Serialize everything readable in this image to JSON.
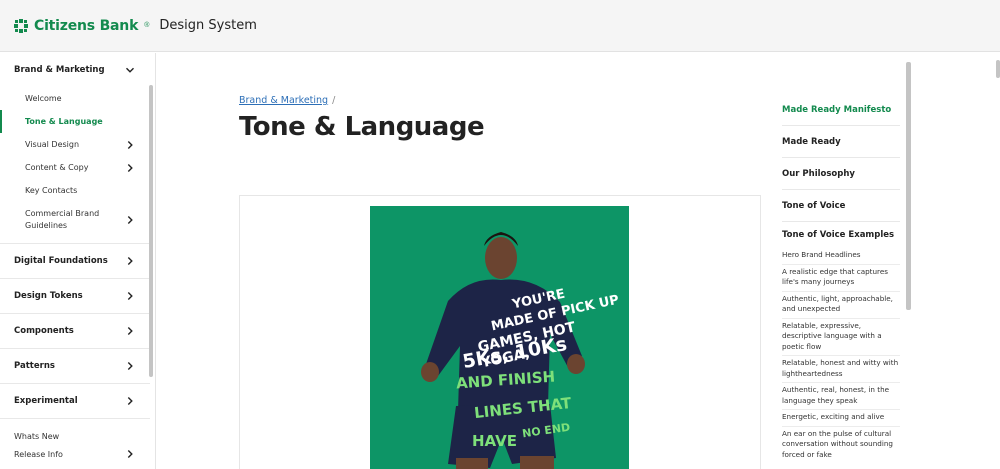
{
  "header": {
    "brand": "Citizens Bank",
    "brand_mark": "®",
    "product": "Design System",
    "logo_color": "#138a4e"
  },
  "sidebar": {
    "sections": [
      {
        "label": "Brand & Marketing",
        "expanded": true,
        "items": [
          {
            "label": "Welcome",
            "has_children": false,
            "active": false
          },
          {
            "label": "Tone & Language",
            "has_children": false,
            "active": true
          },
          {
            "label": "Visual Design",
            "has_children": true,
            "active": false
          },
          {
            "label": "Content & Copy",
            "has_children": true,
            "active": false
          },
          {
            "label": "Key Contacts",
            "has_children": false,
            "active": false
          },
          {
            "label": "Commercial Brand Guidelines",
            "has_children": true,
            "active": false
          }
        ]
      },
      {
        "label": "Digital Foundations"
      },
      {
        "label": "Design Tokens"
      },
      {
        "label": "Components"
      },
      {
        "label": "Patterns"
      },
      {
        "label": "Experimental"
      }
    ],
    "footer": [
      {
        "label": "Whats New"
      },
      {
        "label": "Release Info"
      }
    ]
  },
  "main": {
    "breadcrumb": {
      "link": "Brand & Marketing",
      "separator": "/"
    },
    "title": "Tone & Language",
    "hero": {
      "text_lines": [
        "YOU'RE",
        "MADE OF PICK UP",
        "GAMES, HOT YOGA,",
        "5Ks, 10Ks",
        "AND FINISH",
        "LINES THAT",
        "HAVE",
        "NO END"
      ],
      "bg_color": "#0d9566",
      "accent_color": "#7ee07a"
    }
  },
  "toc": {
    "items": [
      {
        "label": "Made Ready Manifesto",
        "active": true
      },
      {
        "label": "Made Ready",
        "active": false
      },
      {
        "label": "Our Philosophy",
        "active": false
      },
      {
        "label": "Tone of Voice",
        "active": false
      },
      {
        "label": "Tone of Voice Examples",
        "active": false
      }
    ],
    "sub_items": [
      "Hero Brand Headlines",
      "A realistic edge that captures life's many journeys",
      "Authentic, light, approachable, and unexpected",
      "Relatable, expressive, descriptive language with a poetic flow",
      "Relatable, honest and witty with lightheartedness",
      "Authentic, real, honest, in the language they speak",
      "Energetic, exciting and alive",
      "An ear on the pulse of cultural conversation without sounding forced or fake"
    ]
  }
}
